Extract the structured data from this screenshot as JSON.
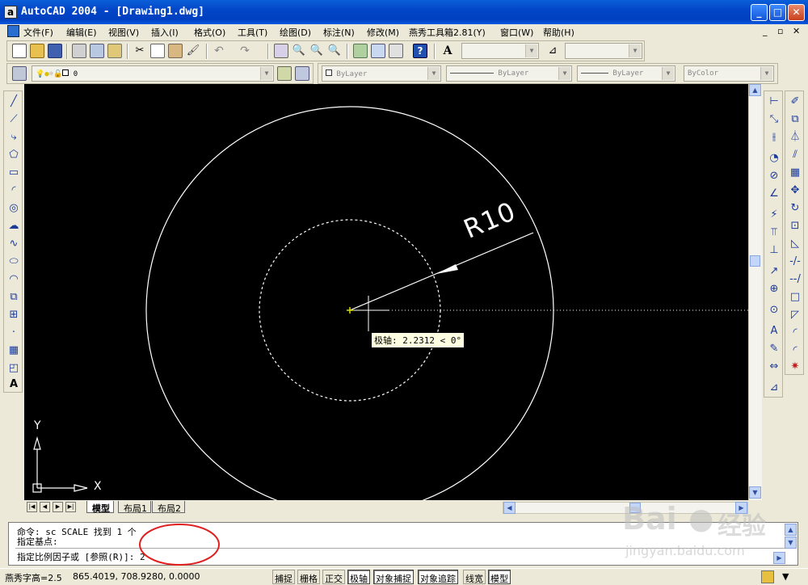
{
  "window": {
    "app_icon": "autocad-icon",
    "title": "AutoCAD 2004 - [Drawing1.dwg]",
    "min_label": "_",
    "max_label": "□",
    "close_label": "✕"
  },
  "menu": {
    "items": [
      "文件(F)",
      "编辑(E)",
      "视图(V)",
      "插入(I)",
      "格式(O)",
      "工具(T)",
      "绘图(D)",
      "标注(N)",
      "修改(M)",
      "燕秀工具箱2.81(Y)",
      "窗口(W)",
      "帮助(H)"
    ],
    "mdi": {
      "min": "_",
      "restore": "▫",
      "close": "✕"
    }
  },
  "layer_toolbar": {
    "layer_value": "0"
  },
  "properties_toolbar": {
    "color": "ByLayer",
    "linetype": "ByLayer",
    "lineweight": "ByLayer",
    "plotstyle": "ByColor"
  },
  "drawing": {
    "radius_label": "R10",
    "tooltip": "极轴: 2.2312 < 0°",
    "ucs_x": "X",
    "ucs_y": "Y"
  },
  "layout_tabs": [
    "模型",
    "布局1",
    "布局2"
  ],
  "command": {
    "line1": "命令: sc SCALE 找到 1 个",
    "line2": "指定基点:",
    "line3": "指定比例因子或 [参照(R)]: 2"
  },
  "status": {
    "text_height": "燕秀字高=2.5",
    "coords": "865.4019, 708.9280, 0.0000",
    "toggles": [
      {
        "label": "捕捉",
        "on": false
      },
      {
        "label": "栅格",
        "on": false
      },
      {
        "label": "正交",
        "on": false
      },
      {
        "label": "极轴",
        "on": true
      },
      {
        "label": "对象捕捉",
        "on": true
      },
      {
        "label": "对象追踪",
        "on": true
      },
      {
        "label": "线宽",
        "on": false
      },
      {
        "label": "模型",
        "on": true
      }
    ]
  },
  "watermark": {
    "brand": "Bai",
    "brand2": "经验",
    "url": "jingyan.baidu.com"
  },
  "colors": {
    "titlebar": "#0346c8",
    "canvas": "#000000",
    "tooltip_bg": "#ffffe1",
    "annotation_red": "#e02020"
  }
}
